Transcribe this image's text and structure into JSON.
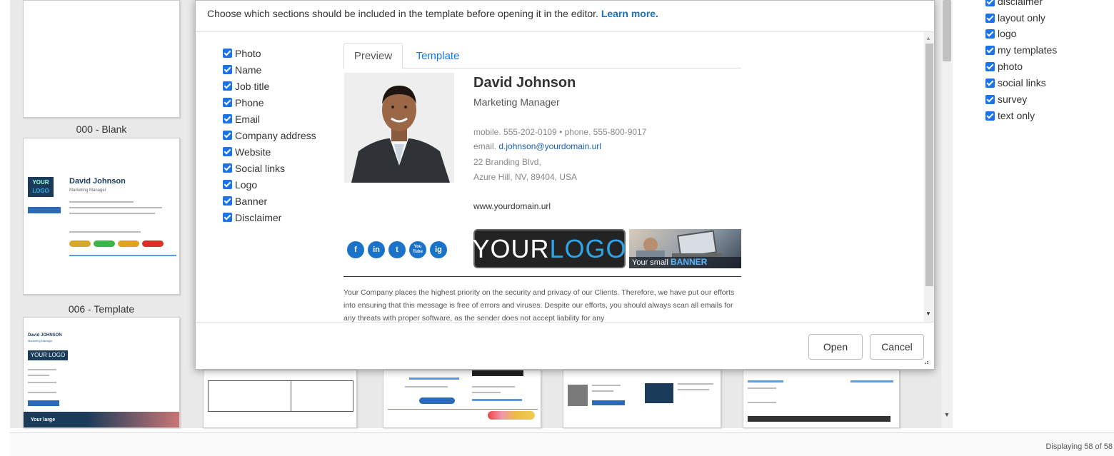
{
  "background": {
    "templates": [
      {
        "label": "000 - Blank"
      },
      {
        "label": "006 - Template"
      }
    ],
    "card_sample": {
      "logo_text": "YOUR",
      "logo_text2": "LOGO",
      "name": "David Johnson",
      "role": "Marketing Manager"
    },
    "card_sample2": {
      "name": "David JOHNSON",
      "role": "Marketing Manager",
      "logo_text": "YOUR LOGO",
      "banner_text": "Your large"
    },
    "filters": [
      {
        "label": "disclaimer"
      },
      {
        "label": "layout only"
      },
      {
        "label": "logo"
      },
      {
        "label": "my templates"
      },
      {
        "label": "photo"
      },
      {
        "label": "social links"
      },
      {
        "label": "survey"
      },
      {
        "label": "text only"
      }
    ],
    "footer_text": "Displaying 58 of 58"
  },
  "modal": {
    "description": "Choose which sections should be included in the template before opening it in the editor.",
    "learn_more": "Learn more.",
    "sections": [
      {
        "label": "Photo",
        "checked": true
      },
      {
        "label": "Name",
        "checked": true
      },
      {
        "label": "Job title",
        "checked": true
      },
      {
        "label": "Phone",
        "checked": true
      },
      {
        "label": "Email",
        "checked": true
      },
      {
        "label": "Company address",
        "checked": true
      },
      {
        "label": "Website",
        "checked": true
      },
      {
        "label": "Social links",
        "checked": true
      },
      {
        "label": "Logo",
        "checked": true
      },
      {
        "label": "Banner",
        "checked": true
      },
      {
        "label": "Disclaimer",
        "checked": true
      }
    ],
    "tabs": {
      "preview": "Preview",
      "template": "Template"
    },
    "signature": {
      "name": "David Johnson",
      "title": "Marketing Manager",
      "phones": "mobile. 555-202-0109 • phone. 555-800-9017",
      "email_label": "email.",
      "email": "d.johnson@yourdomain.url",
      "address1": "22 Branding Blvd,",
      "address2": "Azure Hill, NV, 89404, USA",
      "website": "www.yourdomain.url",
      "logo_your": "YOUR",
      "logo_logo": "LOGO",
      "banner_small": "Your small",
      "banner_big": "BANNER",
      "social": [
        "f",
        "in",
        "t",
        "You Tube",
        "ig"
      ],
      "disclaimer": "Your Company places the highest priority on the security and privacy of our Clients. Therefore, we have put our efforts into ensuring that this message is free of errors and viruses. Despite our efforts, you should always scan all emails for any threats with proper software, as the sender does not accept liability for any"
    },
    "buttons": {
      "open": "Open",
      "cancel": "Cancel"
    }
  },
  "colors": {
    "accent": "#1a73e8",
    "link": "#1a6fc0",
    "checkbox": "#1a73e8"
  }
}
